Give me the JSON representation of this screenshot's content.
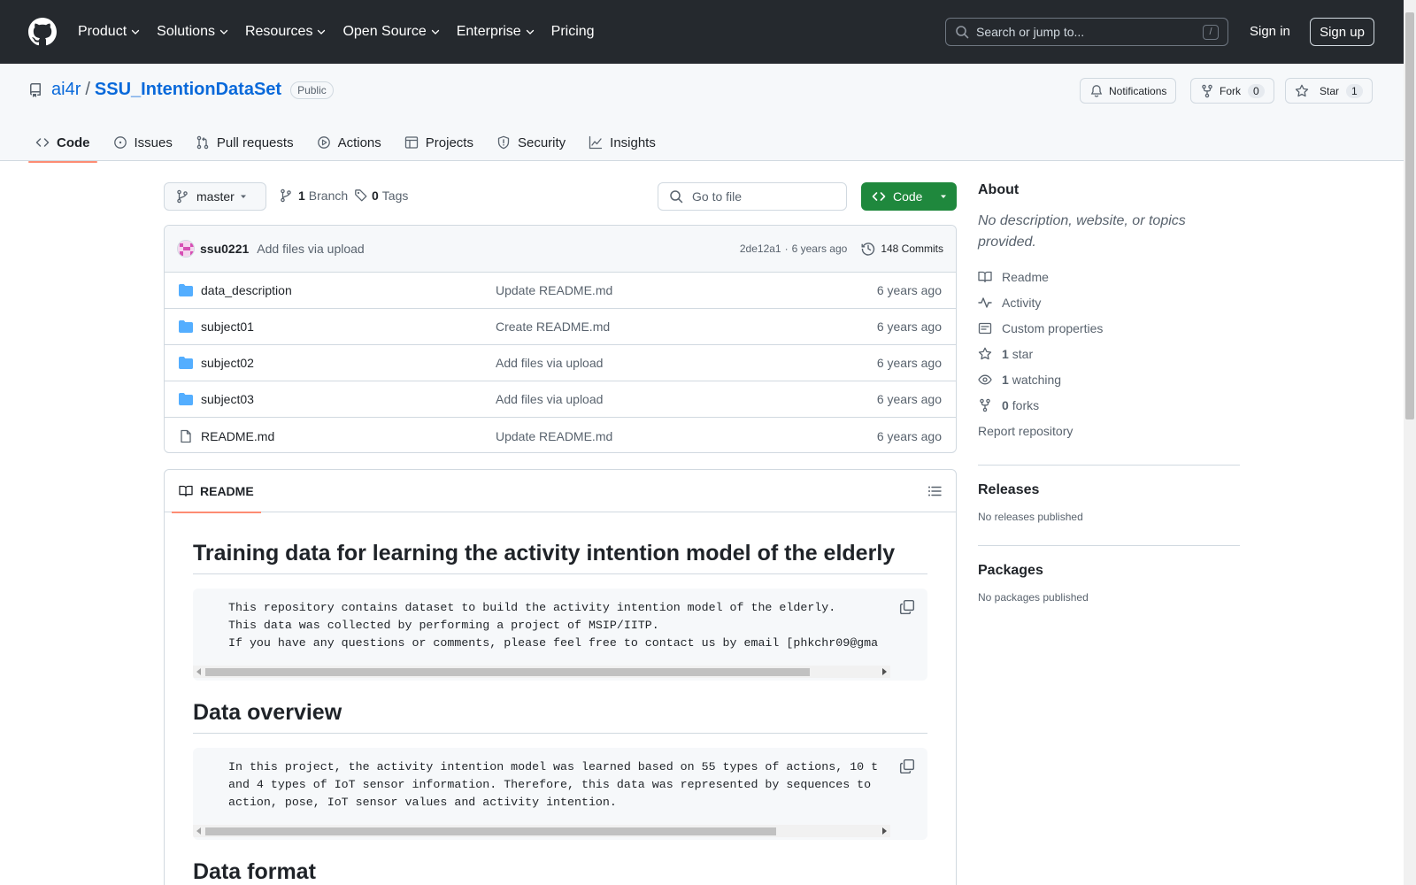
{
  "header": {
    "nav": [
      "Product",
      "Solutions",
      "Resources",
      "Open Source",
      "Enterprise",
      "Pricing"
    ],
    "nav_has_chevron": [
      true,
      true,
      true,
      true,
      true,
      false
    ],
    "search_placeholder": "Search or jump to...",
    "search_shortcut": "/",
    "sign_in": "Sign in",
    "sign_up": "Sign up"
  },
  "repo": {
    "owner": "ai4r",
    "separator": "/",
    "name": "SSU_IntentionDataSet",
    "visibility": "Public",
    "notifications_label": "Notifications",
    "fork_label": "Fork",
    "fork_count": "0",
    "star_label": "Star",
    "star_count": "1"
  },
  "tabs": [
    {
      "label": "Code",
      "icon": "code-icon",
      "active": true
    },
    {
      "label": "Issues",
      "icon": "issue-icon",
      "active": false
    },
    {
      "label": "Pull requests",
      "icon": "pull-request-icon",
      "active": false
    },
    {
      "label": "Actions",
      "icon": "play-icon",
      "active": false
    },
    {
      "label": "Projects",
      "icon": "table-icon",
      "active": false
    },
    {
      "label": "Security",
      "icon": "shield-icon",
      "active": false
    },
    {
      "label": "Insights",
      "icon": "graph-icon",
      "active": false
    }
  ],
  "toolbar": {
    "branch": "master",
    "branch_count": "1",
    "branch_label": "Branch",
    "tag_count": "0",
    "tag_label": "Tags",
    "goto_placeholder": "Go to file",
    "code_label": "Code"
  },
  "commit": {
    "author": "ssu0221",
    "message": "Add files via upload",
    "hash": "2de12a1",
    "dot": "·",
    "age": "6 years ago",
    "commits_label": "148 Commits"
  },
  "files": [
    {
      "name": "data_description",
      "type": "folder",
      "message": "Update README.md",
      "date": "6 years ago"
    },
    {
      "name": "subject01",
      "type": "folder",
      "message": "Create README.md",
      "date": "6 years ago"
    },
    {
      "name": "subject02",
      "type": "folder",
      "message": "Add files via upload",
      "date": "6 years ago"
    },
    {
      "name": "subject03",
      "type": "folder",
      "message": "Add files via upload",
      "date": "6 years ago"
    },
    {
      "name": "README.md",
      "type": "file",
      "message": "Update README.md",
      "date": "6 years ago"
    }
  ],
  "readme": {
    "tab_label": "README",
    "h1": "Training data for learning the activity intention model of the elderly",
    "code1": [
      "This repository contains dataset to build the activity intention model of the elderly.",
      "This data was collected by performing a project of MSIP/IITP.",
      "If you have any questions or comments, please feel free to contact us by email [phkchr09@gma"
    ],
    "h2a": "Data overview",
    "code2": [
      "In this project, the activity intention model was learned based on 55 types of actions, 10 t",
      "and 4 types of IoT sensor information. Therefore, this data was represented by sequences to",
      "action, pose, IoT sensor values and activity intention."
    ],
    "h2b": "Data format"
  },
  "about": {
    "title": "About",
    "description": "No description, website, or topics provided.",
    "readme": "Readme",
    "activity": "Activity",
    "custom_properties": "Custom properties",
    "stars_count": "1",
    "stars_label": "star",
    "watching_count": "1",
    "watching_label": "watching",
    "forks_count": "0",
    "forks_label": "forks",
    "report": "Report repository"
  },
  "releases": {
    "title": "Releases",
    "empty": "No releases published"
  },
  "packages": {
    "title": "Packages",
    "empty": "No packages published"
  },
  "colors": {
    "accent_blue": "#0969da",
    "green": "#1f883d",
    "header_bg": "#25292e",
    "tab_underline": "#fd8c73",
    "folder": "#54aeff"
  }
}
